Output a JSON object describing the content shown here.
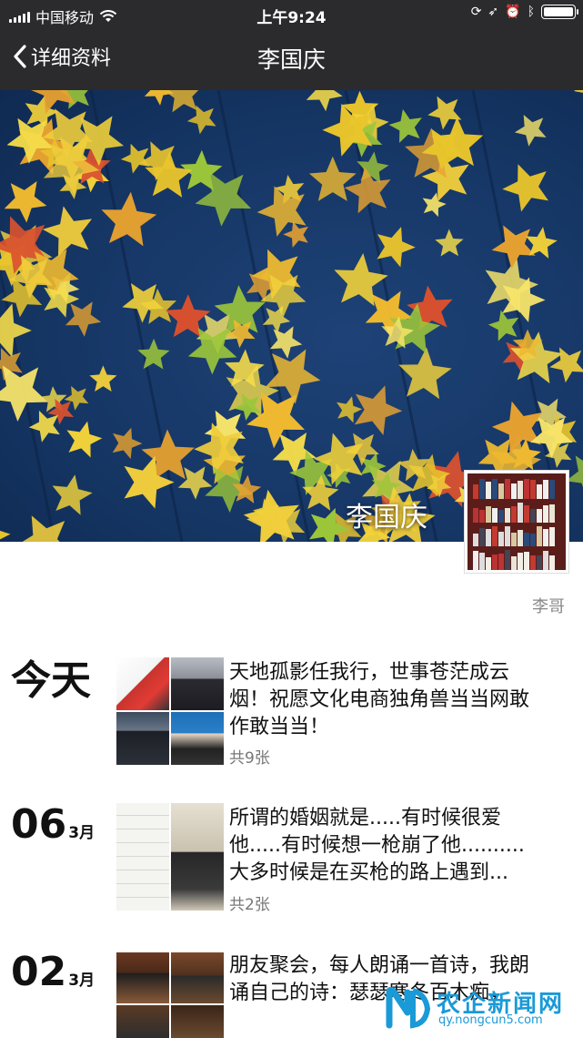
{
  "status_bar": {
    "carrier": "中国移动",
    "time": "上午9:24",
    "battery_level": 1.0
  },
  "nav": {
    "back_label": "详细资料",
    "title": "李国庆"
  },
  "profile": {
    "cover_name": "李国庆",
    "sub_name": "李哥"
  },
  "posts": [
    {
      "date_label": "今天",
      "day": "",
      "month": "",
      "text": "天地孤影任我行，世事苍茫成云烟！祝愿文化电商独角兽当当网敢作敢当当！",
      "count": "共9张"
    },
    {
      "date_label": "",
      "day": "06",
      "month": "3月",
      "text": "所谓的婚姻就是.....有时候很爱他.....有时候想一枪崩了他..........大多时候是在买枪的路上遇到...",
      "count": "共2张"
    },
    {
      "date_label": "",
      "day": "02",
      "month": "3月",
      "text": "朋友聚会，每人朗诵一首诗，我朗诵自己的诗：瑟瑟寒冬百木痴，",
      "count": ""
    }
  ],
  "watermark": {
    "title": "农企新闻网",
    "url": "qy.nongcun5.com"
  },
  "colors": {
    "nav_bg": "#2b2b2d",
    "cover_bg": "#163766",
    "leaf_yellow": "#f2d23a",
    "watermark_blue": "#1a9ad7"
  }
}
